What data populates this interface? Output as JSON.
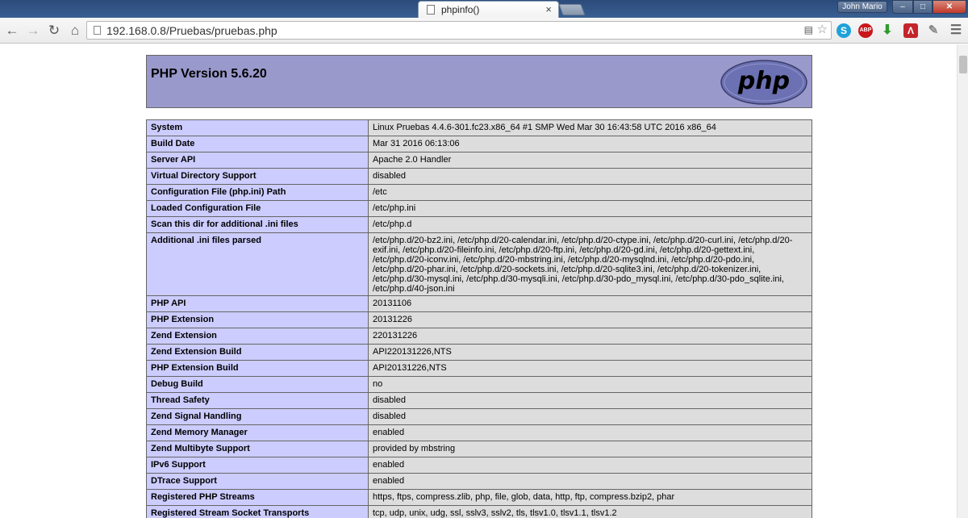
{
  "browser": {
    "tab_title": "phpinfo()",
    "tab_close": "×",
    "user_name": "John Mario",
    "url": "192.168.0.8/Pruebas/pruebas.php"
  },
  "page": {
    "heading": "PHP Version 5.6.20",
    "logo_text": "php",
    "rows": [
      {
        "key": "System",
        "value": "Linux Pruebas 4.4.6-301.fc23.x86_64 #1 SMP Wed Mar 30 16:43:58 UTC 2016 x86_64"
      },
      {
        "key": "Build Date",
        "value": "Mar 31 2016 06:13:06"
      },
      {
        "key": "Server API",
        "value": "Apache 2.0 Handler"
      },
      {
        "key": "Virtual Directory Support",
        "value": "disabled"
      },
      {
        "key": "Configuration File (php.ini) Path",
        "value": "/etc"
      },
      {
        "key": "Loaded Configuration File",
        "value": "/etc/php.ini"
      },
      {
        "key": "Scan this dir for additional .ini files",
        "value": "/etc/php.d"
      },
      {
        "key": "Additional .ini files parsed",
        "value": "/etc/php.d/20-bz2.ini, /etc/php.d/20-calendar.ini, /etc/php.d/20-ctype.ini, /etc/php.d/20-curl.ini, /etc/php.d/20-exif.ini, /etc/php.d/20-fileinfo.ini, /etc/php.d/20-ftp.ini, /etc/php.d/20-gd.ini, /etc/php.d/20-gettext.ini, /etc/php.d/20-iconv.ini, /etc/php.d/20-mbstring.ini, /etc/php.d/20-mysqlnd.ini, /etc/php.d/20-pdo.ini, /etc/php.d/20-phar.ini, /etc/php.d/20-sockets.ini, /etc/php.d/20-sqlite3.ini, /etc/php.d/20-tokenizer.ini, /etc/php.d/30-mysql.ini, /etc/php.d/30-mysqli.ini, /etc/php.d/30-pdo_mysql.ini, /etc/php.d/30-pdo_sqlite.ini, /etc/php.d/40-json.ini"
      },
      {
        "key": "PHP API",
        "value": "20131106"
      },
      {
        "key": "PHP Extension",
        "value": "20131226"
      },
      {
        "key": "Zend Extension",
        "value": "220131226"
      },
      {
        "key": "Zend Extension Build",
        "value": "API220131226,NTS"
      },
      {
        "key": "PHP Extension Build",
        "value": "API20131226,NTS"
      },
      {
        "key": "Debug Build",
        "value": "no"
      },
      {
        "key": "Thread Safety",
        "value": "disabled"
      },
      {
        "key": "Zend Signal Handling",
        "value": "disabled"
      },
      {
        "key": "Zend Memory Manager",
        "value": "enabled"
      },
      {
        "key": "Zend Multibyte Support",
        "value": "provided by mbstring"
      },
      {
        "key": "IPv6 Support",
        "value": "enabled"
      },
      {
        "key": "DTrace Support",
        "value": "enabled"
      },
      {
        "key": "Registered PHP Streams",
        "value": "https, ftps, compress.zlib, php, file, glob, data, http, ftp, compress.bzip2, phar"
      },
      {
        "key": "Registered Stream Socket Transports",
        "value": "tcp, udp, unix, udg, ssl, sslv3, sslv2, tls, tlsv1.0, tlsv1.1, tlsv1.2"
      }
    ]
  }
}
